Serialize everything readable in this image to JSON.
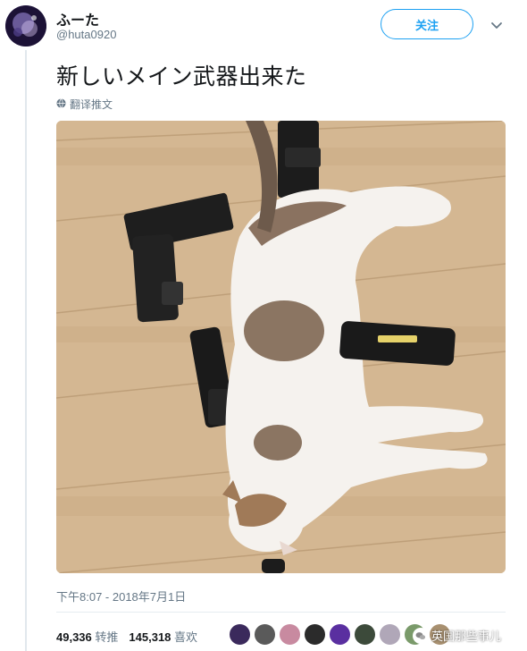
{
  "user": {
    "display_name": "ふーた",
    "handle": "@huta0920"
  },
  "follow_button": {
    "label": "关注"
  },
  "tweet": {
    "text": "新しいメイン武器出来た",
    "translate_label": "翻译推文",
    "timestamp": "下午8:07 - 2018年7月1日"
  },
  "stats": {
    "retweets_count": "49,336",
    "retweets_label": "转推",
    "likes_count": "145,318",
    "likes_label": "喜欢"
  },
  "likers": [
    {
      "color": "#3b2a5c"
    },
    {
      "color": "#5a5a5a"
    },
    {
      "color": "#c88aa0"
    },
    {
      "color": "#2b2b2b"
    },
    {
      "color": "#5a2fa0"
    },
    {
      "color": "#3c4a3a"
    },
    {
      "color": "#b0a7b8"
    },
    {
      "color": "#7a9a6a"
    },
    {
      "color": "#a89070"
    }
  ],
  "watermark": {
    "text": "英国那些事儿"
  },
  "icons": {
    "chevron": "chevron-down-icon",
    "globe": "globe-icon"
  },
  "colors": {
    "accent": "#1da1f2",
    "secondary_text": "#657786"
  }
}
